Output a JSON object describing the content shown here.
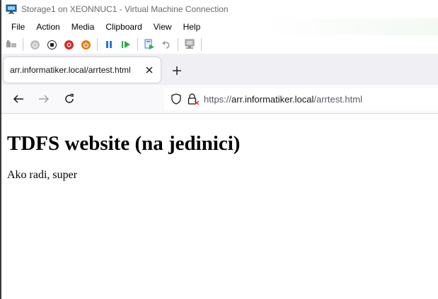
{
  "vm_window": {
    "title": "Storage1 on XEONNUC1 - Virtual Machine Connection",
    "menu": [
      "File",
      "Action",
      "Media",
      "Clipboard",
      "View",
      "Help"
    ],
    "toolbar_icons": [
      "ctrl-alt-del-icon",
      "start-icon",
      "turn-off-icon",
      "shutdown-icon",
      "power-icon",
      "pause-icon",
      "resume-icon",
      "checkpoint-icon",
      "revert-icon",
      "enhanced-session-icon"
    ],
    "colors": {
      "shutdown": "#d42a2a",
      "power": "#e07b16",
      "pause": "#2378d1",
      "resume": "#2fa84f"
    }
  },
  "browser": {
    "tab": {
      "title": "arr.informatiker.local/arrtest.html"
    },
    "url": {
      "scheme": "https://",
      "host": "arr.informatiker.local",
      "path": "/arrtest.html"
    }
  },
  "page": {
    "heading": "TDFS website (na jedinici)",
    "paragraph": "Ako radi, super"
  }
}
